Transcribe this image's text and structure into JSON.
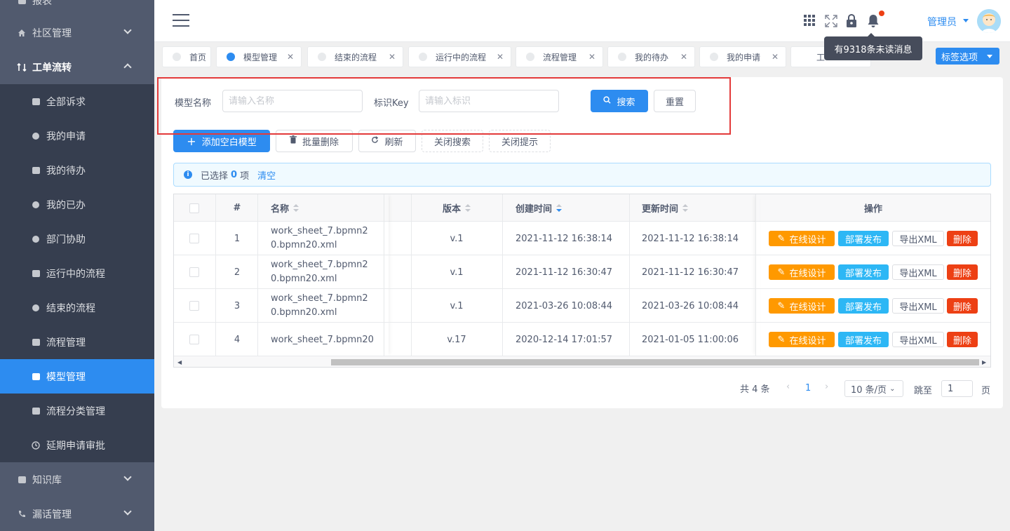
{
  "sidebar": {
    "top_partial": "报表",
    "community": "社区管理",
    "workflow": "工单流转",
    "items": [
      "全部诉求",
      "我的申请",
      "我的待办",
      "我的已办",
      "部门协助",
      "运行中的流程",
      "结束的流程",
      "流程管理",
      "模型管理",
      "流程分类管理",
      "延期申请审批"
    ],
    "knowledge": "知识库",
    "calls": "漏话管理"
  },
  "header": {
    "user_name": "管理员",
    "tooltip": "有9318条未读消息"
  },
  "tags": [
    {
      "label": "首页",
      "closable": false
    },
    {
      "label": "模型管理",
      "closable": true,
      "active": true
    },
    {
      "label": "结束的流程",
      "closable": true
    },
    {
      "label": "运行中的流程",
      "closable": true
    },
    {
      "label": "流程管理",
      "closable": true
    },
    {
      "label": "我的待办",
      "closable": true
    },
    {
      "label": "我的申请",
      "closable": true
    },
    {
      "label": "工",
      "closable": false
    }
  ],
  "tag_select": "标签选项",
  "search": {
    "name_label": "模型名称",
    "name_placeholder": "请输入名称",
    "key_label": "标识Key",
    "key_placeholder": "请输入标识",
    "search_btn": "搜索",
    "reset_btn": "重置"
  },
  "toolbar": {
    "add": "添加空白模型",
    "batch_delete": "批量删除",
    "refresh": "刷新",
    "close_search": "关闭搜索",
    "close_tip": "关闭提示"
  },
  "alert": {
    "prefix": "已选择",
    "count": "0",
    "suffix": "项",
    "clear": "清空"
  },
  "table": {
    "headers": {
      "index": "#",
      "name": "名称",
      "version": "版本",
      "created": "创建时间",
      "updated": "更新时间",
      "actions": "操作"
    },
    "rows": [
      {
        "index": "1",
        "name_line1": "work_sheet_7.bpmn2",
        "name_line2": "0.bpmn20.xml",
        "version": "v.1",
        "created": "2021-11-12 16:38:14",
        "updated": "2021-11-12 16:38:14"
      },
      {
        "index": "2",
        "name_line1": "work_sheet_7.bpmn2",
        "name_line2": "0.bpmn20.xml",
        "version": "v.1",
        "created": "2021-11-12 16:30:47",
        "updated": "2021-11-12 16:30:47"
      },
      {
        "index": "3",
        "name_line1": "work_sheet_7.bpmn2",
        "name_line2": "0.bpmn20.xml",
        "version": "v.1",
        "created": "2021-03-26 10:08:44",
        "updated": "2021-03-26 10:08:44"
      },
      {
        "index": "4",
        "name_line1": "work_sheet_7.bpmn20",
        "name_line2": "",
        "version": "v.17",
        "created": "2020-12-14 17:01:57",
        "updated": "2021-01-05 11:00:06"
      }
    ],
    "actions": {
      "design": "在线设计",
      "deploy": "部署发布",
      "export": "导出XML",
      "delete": "删除"
    }
  },
  "pager": {
    "total": "共 4 条",
    "current": "1",
    "page_size": "10 条/页",
    "jump_label": "跳至",
    "jump_value": "1",
    "page_unit": "页"
  },
  "colors": {
    "primary": "#2d8cf0",
    "sidebar": "#515a6e",
    "sidebar_sub": "#363e4f",
    "warning": "#ff9900",
    "info": "#2db7f5",
    "danger": "#ed4014",
    "highlight_box": "#e33a3a"
  }
}
